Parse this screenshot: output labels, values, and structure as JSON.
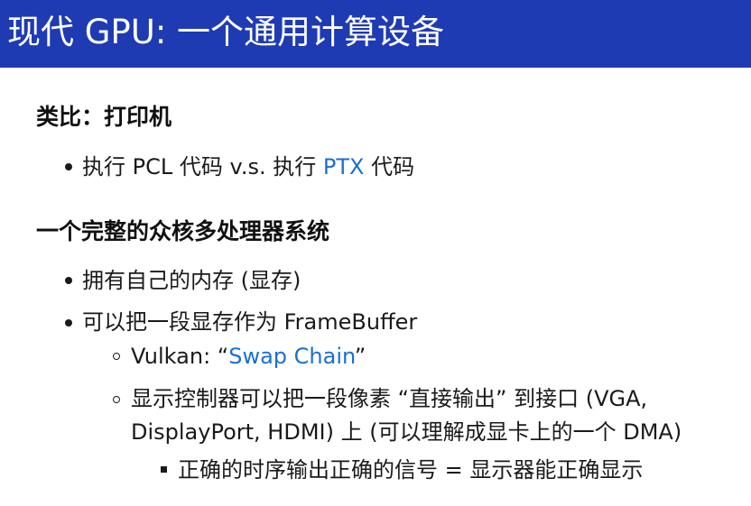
{
  "slide": {
    "title": "现代 GPU: 一个通用计算设备"
  },
  "section1": {
    "heading": "类比：打印机",
    "item1": {
      "before": "执行 PCL 代码 v.s. 执行 ",
      "link": "PTX",
      "after": " 代码"
    }
  },
  "section2": {
    "heading": "一个完整的众核多处理器系统",
    "item1": "拥有自己的内存 (显存)",
    "item2": "可以把一段显存作为 FrameBuffer",
    "sub1": {
      "before": "Vulkan: “",
      "link": "Swap Chain",
      "after": "”"
    },
    "sub2": {
      "line1": "显示控制器可以把一段像素 “直接输出” 到接口 (VGA,",
      "line2": "DisplayPort, HDMI) 上 (可以理解成显卡上的一个 DMA)"
    },
    "subsub1": "正确的时序输出正确的信号 = 显示器能正确显示"
  },
  "colors": {
    "title_bar": "#1f3bb3",
    "link": "#1a6fd1"
  }
}
